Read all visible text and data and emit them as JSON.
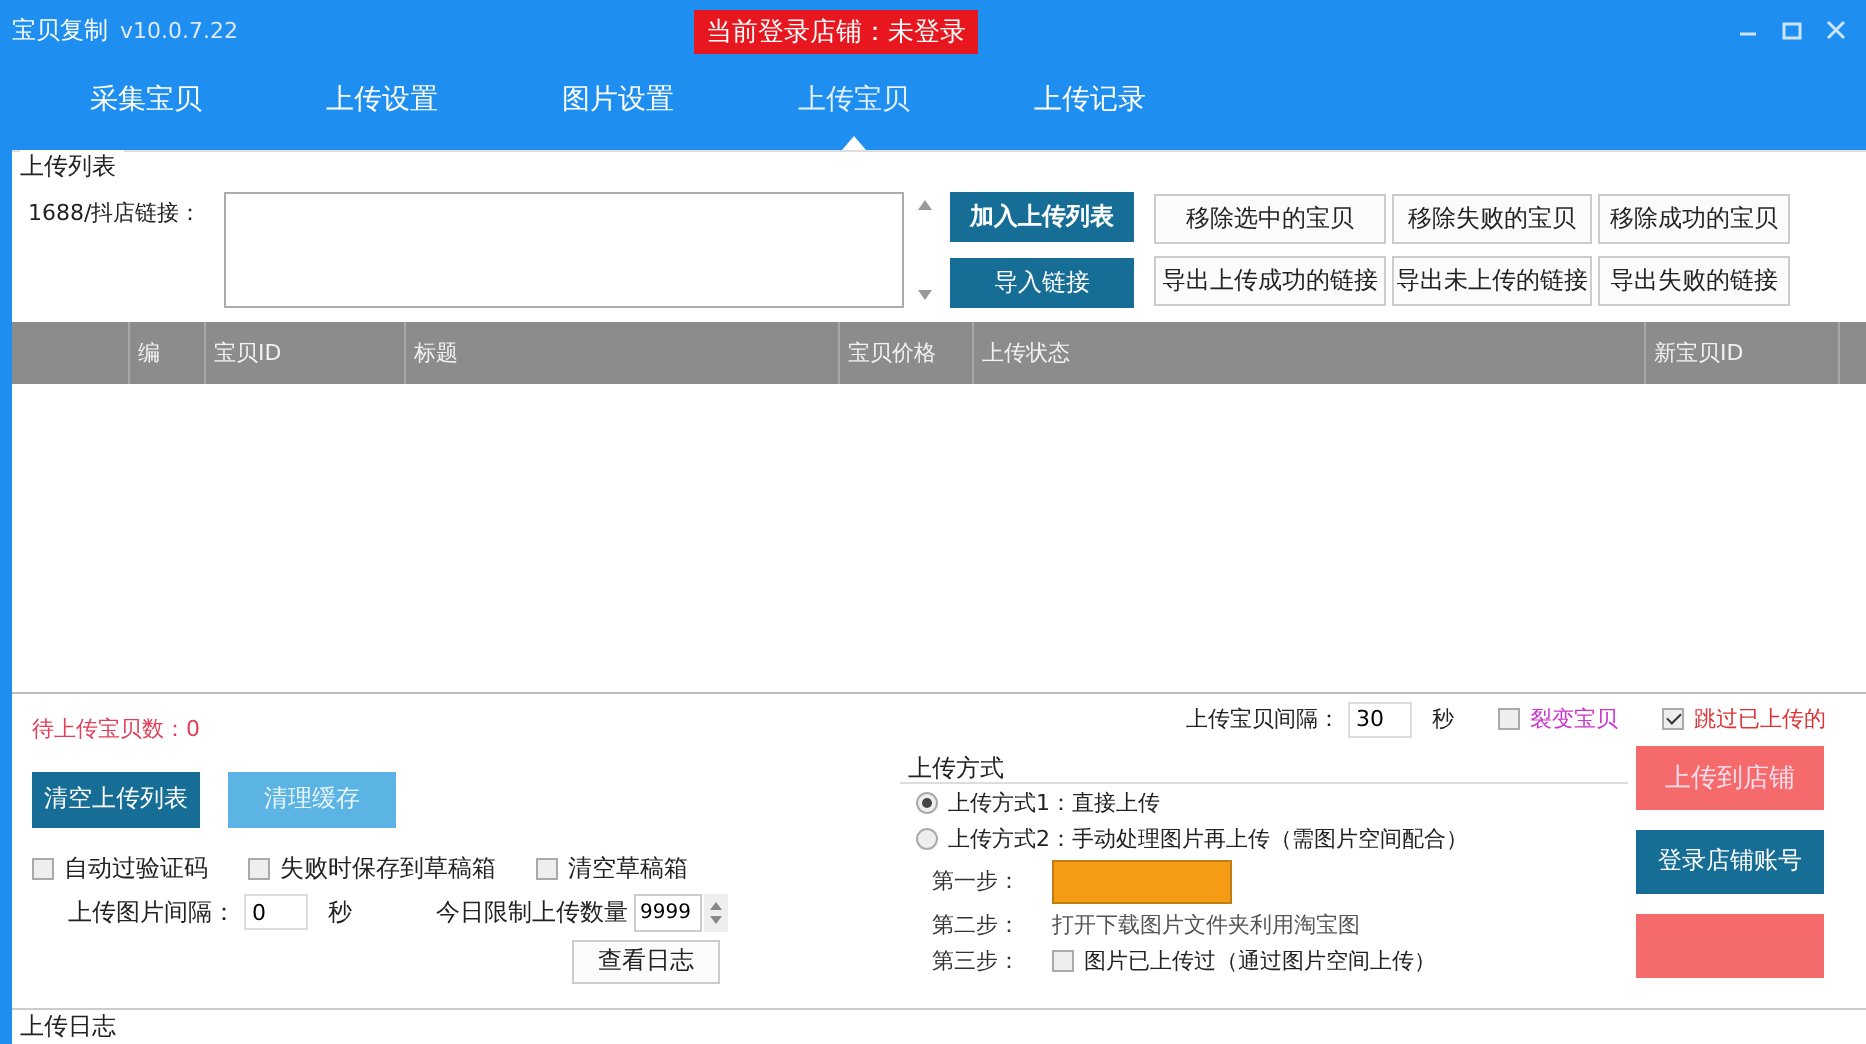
{
  "window": {
    "title": "宝贝复制",
    "version": "v10.0.7.22",
    "login_status": "当前登录店铺：未登录"
  },
  "tabs": [
    {
      "label": "采集宝贝",
      "selected": false
    },
    {
      "label": "上传设置",
      "selected": false
    },
    {
      "label": "图片设置",
      "selected": false
    },
    {
      "label": "上传宝贝",
      "selected": true
    },
    {
      "label": "上传记录",
      "selected": false
    }
  ],
  "upload_list": {
    "title": "上传列表",
    "link_label": "1688/抖店链接：",
    "add_button": "加入上传列表",
    "import_button": "导入链接",
    "actions": [
      "移除选中的宝贝",
      "移除失败的宝贝",
      "移除成功的宝贝",
      "导出上传成功的链接",
      "导出未上传的链接",
      "导出失败的链接"
    ]
  },
  "table": {
    "columns": [
      "编",
      "宝贝ID",
      "标题",
      "宝贝价格",
      "上传状态",
      "新宝贝ID"
    ]
  },
  "bottom": {
    "pending": "待上传宝贝数：0",
    "clear_button": "清空上传列表",
    "cache_button": "清理缓存",
    "options": [
      {
        "label": "自动过验证码",
        "checked": false
      },
      {
        "label": "失败时保存到草稿箱",
        "checked": false
      },
      {
        "label": "清空草稿箱",
        "checked": false
      }
    ],
    "image_interval_label": "上传图片间隔：",
    "image_interval": "0",
    "image_interval_unit": "秒",
    "daily_limit_label": "今日限制上传数量",
    "daily_limit": "9999",
    "log_button": "查看日志",
    "item_interval_label": "上传宝贝间隔：",
    "item_interval": "30",
    "item_interval_unit": "秒",
    "flags": [
      {
        "label": "裂变宝贝",
        "checked": false,
        "color": "#cc33cc"
      },
      {
        "label": "跳过已上传的",
        "checked": true,
        "color": "#dd3333"
      }
    ]
  },
  "upload_method": {
    "title": "上传方式",
    "methods": [
      {
        "label": "上传方式1：直接上传",
        "selected": true
      },
      {
        "label": "上传方式2：手动处理图片再上传（需图片空间配合）",
        "selected": false
      }
    ],
    "steps": [
      {
        "label": "第一步：",
        "kind": "button"
      },
      {
        "label": "第二步：",
        "kind": "text",
        "text": "打开下载图片文件夹利用淘宝图"
      },
      {
        "label": "第三步：",
        "kind": "checkbox",
        "text": "图片已上传过（通过图片空间上传）",
        "checked": false
      }
    ]
  },
  "actions": {
    "upload_button": "上传到店铺",
    "login_button": "登录店铺账号"
  },
  "footer": {
    "log_title": "上传日志"
  }
}
